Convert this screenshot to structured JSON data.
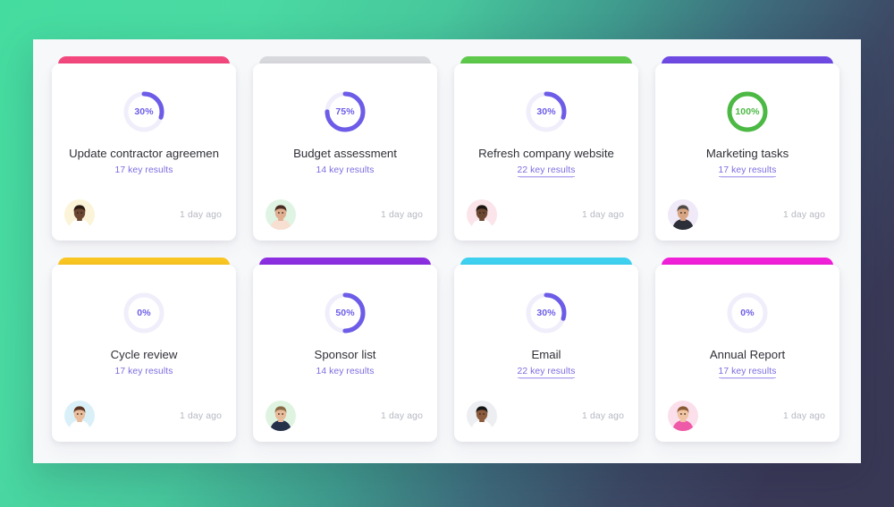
{
  "background": {
    "gradient_from": "#45dca0",
    "gradient_to": "#393854"
  },
  "panel": {
    "surface_color": "#f7f8fa"
  },
  "cards": [
    {
      "id": "update-contractor-agreement",
      "accent_color": "#f2487e",
      "progress": 30,
      "progress_label": "30%",
      "progress_color": "#6c5ce7",
      "track_color": "#f0eefb",
      "title": "Update contractor agreemen",
      "key_results": "17 key results",
      "key_results_underlined": false,
      "avatar_bg": "#fbf4d9",
      "avatar_skin": "#6b4630",
      "avatar_hair": "#2b1a12",
      "avatar_shirt": "#ffffff",
      "time_ago": "1 day ago"
    },
    {
      "id": "budget-assessment",
      "accent_color": "#d8d9dd",
      "progress": 75,
      "progress_label": "75%",
      "progress_color": "#6c5ce7",
      "track_color": "#f0eefb",
      "title": "Budget assessment",
      "key_results": "14 key results",
      "key_results_underlined": false,
      "avatar_bg": "#dff4e3",
      "avatar_skin": "#e0ae90",
      "avatar_hair": "#4a2d20",
      "avatar_shirt": "#f7dfd2",
      "time_ago": "1 day ago"
    },
    {
      "id": "refresh-company-website",
      "accent_color": "#5ec94b",
      "progress": 30,
      "progress_label": "30%",
      "progress_color": "#6c5ce7",
      "track_color": "#f0eefb",
      "title": "Refresh company website",
      "key_results": "22 key results",
      "key_results_underlined": true,
      "avatar_bg": "#fbe4ea",
      "avatar_skin": "#6b4630",
      "avatar_hair": "#1d1410",
      "avatar_shirt": "#ffffff",
      "time_ago": "1 day ago"
    },
    {
      "id": "marketing-tasks",
      "accent_color": "#6e4ae3",
      "progress": 100,
      "progress_label": "100%",
      "progress_color": "#4cb944",
      "track_color": "#eef4ee",
      "title": "Marketing tasks",
      "key_results": "17 key results",
      "key_results_underlined": true,
      "avatar_bg": "#efe9f8",
      "avatar_skin": "#d8a584",
      "avatar_hair": "#4f4a46",
      "avatar_shirt": "#2c2f38",
      "time_ago": "1 day ago"
    },
    {
      "id": "cycle-review",
      "accent_color": "#f9c522",
      "progress": 0,
      "progress_label": "0%",
      "progress_color": "#6c5ce7",
      "track_color": "#f0eefb",
      "title": "Cycle review",
      "key_results": "17 key results",
      "key_results_underlined": false,
      "avatar_bg": "#daf0f8",
      "avatar_skin": "#e9bd9c",
      "avatar_hair": "#5a3420",
      "avatar_shirt": "#ffffff",
      "time_ago": "1 day ago"
    },
    {
      "id": "sponsor-list",
      "accent_color": "#8b2fe0",
      "progress": 50,
      "progress_label": "50%",
      "progress_color": "#6c5ce7",
      "track_color": "#f0eefb",
      "title": "Sponsor list",
      "key_results": "14 key results",
      "key_results_underlined": false,
      "avatar_bg": "#dff4e0",
      "avatar_skin": "#e7bb9a",
      "avatar_hair": "#8a6a45",
      "avatar_shirt": "#253049",
      "time_ago": "1 day ago"
    },
    {
      "id": "email",
      "accent_color": "#3fd0f0",
      "progress": 30,
      "progress_label": "30%",
      "progress_color": "#6c5ce7",
      "track_color": "#f0eefb",
      "title": "Email",
      "key_results": "22 key results",
      "key_results_underlined": true,
      "avatar_bg": "#eceef2",
      "avatar_skin": "#8c5a3c",
      "avatar_hair": "#141414",
      "avatar_shirt": "#ffffff",
      "time_ago": "1 day ago"
    },
    {
      "id": "annual-report",
      "accent_color": "#f020d8",
      "progress": 0,
      "progress_label": "0%",
      "progress_color": "#6c5ce7",
      "track_color": "#f0eefb",
      "title": "Annual Report",
      "key_results": "17 key results",
      "key_results_underlined": true,
      "avatar_bg": "#fbe0ec",
      "avatar_skin": "#f0c3a3",
      "avatar_hair": "#8a5a35",
      "avatar_shirt": "#ee5aa8",
      "time_ago": "1 day ago"
    }
  ]
}
